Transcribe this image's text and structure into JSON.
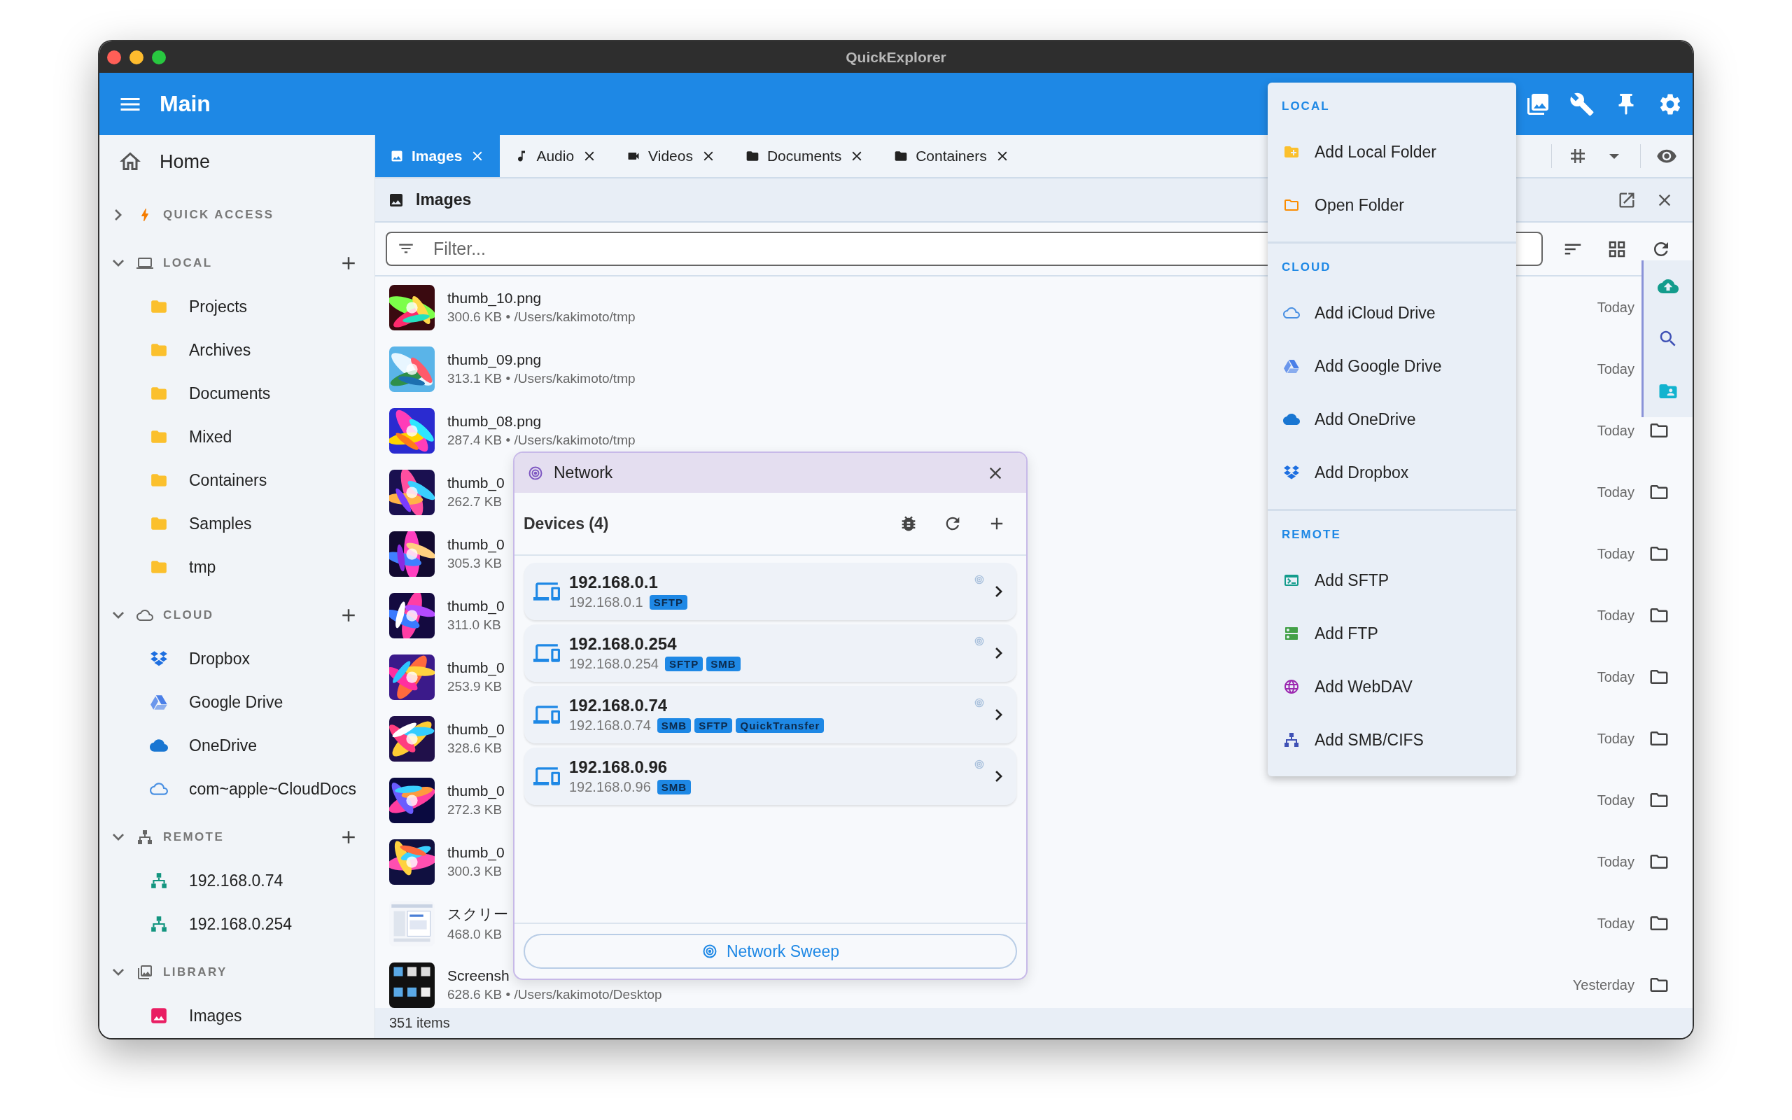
{
  "window": {
    "title": "QuickExplorer"
  },
  "app_bar": {
    "title": "Main"
  },
  "sidebar": {
    "home": "Home",
    "sections": [
      {
        "label": "QUICK ACCESS",
        "kind": "quick",
        "expanded": false,
        "addable": false
      },
      {
        "label": "LOCAL",
        "kind": "local",
        "expanded": true,
        "addable": true,
        "items": [
          {
            "label": "Projects",
            "kind": "folder"
          },
          {
            "label": "Archives",
            "kind": "folder"
          },
          {
            "label": "Documents",
            "kind": "folder"
          },
          {
            "label": "Mixed",
            "kind": "folder"
          },
          {
            "label": "Containers",
            "kind": "folder"
          },
          {
            "label": "Samples",
            "kind": "folder"
          },
          {
            "label": "tmp",
            "kind": "folder"
          }
        ]
      },
      {
        "label": "CLOUD",
        "kind": "cloud",
        "expanded": true,
        "addable": true,
        "items": [
          {
            "label": "Dropbox",
            "kind": "dropbox"
          },
          {
            "label": "Google Drive",
            "kind": "gdrive"
          },
          {
            "label": "OneDrive",
            "kind": "onedrive"
          },
          {
            "label": "com~apple~CloudDocs",
            "kind": "icloud"
          }
        ]
      },
      {
        "label": "REMOTE",
        "kind": "remote",
        "expanded": true,
        "addable": true,
        "items": [
          {
            "label": "192.168.0.74",
            "kind": "server"
          },
          {
            "label": "192.168.0.254",
            "kind": "server"
          }
        ]
      },
      {
        "label": "LIBRARY",
        "kind": "library",
        "expanded": true,
        "addable": false,
        "items": [
          {
            "label": "Images",
            "kind": "images"
          }
        ]
      }
    ]
  },
  "tabs": [
    {
      "label": "Images",
      "kind": "images",
      "selected": true
    },
    {
      "label": "Audio",
      "kind": "audio",
      "selected": false
    },
    {
      "label": "Videos",
      "kind": "video",
      "selected": false
    },
    {
      "label": "Documents",
      "kind": "folder",
      "selected": false
    },
    {
      "label": "Containers",
      "kind": "folder",
      "selected": false
    }
  ],
  "panel": {
    "title": "Images",
    "filter": {
      "placeholder": "Filter..."
    }
  },
  "files": [
    {
      "name": "thumb_10.png",
      "meta": "300.6 KB • /Users/kakimoto/tmp",
      "date": "Today",
      "folder_icon": false
    },
    {
      "name": "thumb_09.png",
      "meta": "313.1 KB • /Users/kakimoto/tmp",
      "date": "Today",
      "folder_icon": false
    },
    {
      "name": "thumb_08.png",
      "meta": "287.4 KB • /Users/kakimoto/tmp",
      "date": "Today",
      "folder_icon": true
    },
    {
      "name": "thumb_0",
      "meta": "262.7 KB",
      "date": "Today",
      "folder_icon": true
    },
    {
      "name": "thumb_0",
      "meta": "305.3 KB",
      "date": "Today",
      "folder_icon": true
    },
    {
      "name": "thumb_0",
      "meta": "311.0 KB",
      "date": "Today",
      "folder_icon": true
    },
    {
      "name": "thumb_0",
      "meta": "253.9 KB",
      "date": "Today",
      "folder_icon": true
    },
    {
      "name": "thumb_0",
      "meta": "328.6 KB",
      "date": "Today",
      "folder_icon": true
    },
    {
      "name": "thumb_0",
      "meta": "272.3 KB",
      "date": "Today",
      "folder_icon": true
    },
    {
      "name": "thumb_0",
      "meta": "300.3 KB",
      "date": "Today",
      "folder_icon": true
    },
    {
      "name": "スクリー",
      "meta": "468.0 KB",
      "date": "Today",
      "folder_icon": true
    },
    {
      "name": "Screensh",
      "meta": "628.6 KB • /Users/kakimoto/Desktop",
      "date": "Yesterday",
      "folder_icon": true
    }
  ],
  "status_bar": "351 items",
  "network": {
    "title": "Network",
    "devices_label": "Devices (4)",
    "devices": [
      {
        "name": "192.168.0.1",
        "address": "192.168.0.1",
        "tags": [
          "SFTP"
        ]
      },
      {
        "name": "192.168.0.254",
        "address": "192.168.0.254",
        "tags": [
          "SFTP",
          "SMB"
        ]
      },
      {
        "name": "192.168.0.74",
        "address": "192.168.0.74",
        "tags": [
          "SMB",
          "SFTP",
          "QuickTransfer"
        ]
      },
      {
        "name": "192.168.0.96",
        "address": "192.168.0.96",
        "tags": [
          "SMB"
        ]
      }
    ],
    "sweep_button": "Network Sweep"
  },
  "add_menu": {
    "sections": [
      {
        "label": "LOCAL",
        "items": [
          {
            "label": "Add Local Folder",
            "kind": "new_folder"
          },
          {
            "label": "Open Folder",
            "kind": "open_folder"
          }
        ]
      },
      {
        "label": "CLOUD",
        "items": [
          {
            "label": "Add iCloud Drive",
            "kind": "icloud"
          },
          {
            "label": "Add Google Drive",
            "kind": "gdrive"
          },
          {
            "label": "Add OneDrive",
            "kind": "onedrive"
          },
          {
            "label": "Add Dropbox",
            "kind": "dropbox"
          }
        ]
      },
      {
        "label": "REMOTE",
        "items": [
          {
            "label": "Add SFTP",
            "kind": "sftp"
          },
          {
            "label": "Add FTP",
            "kind": "ftp"
          },
          {
            "label": "Add WebDAV",
            "kind": "webdav"
          },
          {
            "label": "Add SMB/CIFS",
            "kind": "smb"
          }
        ]
      }
    ]
  }
}
